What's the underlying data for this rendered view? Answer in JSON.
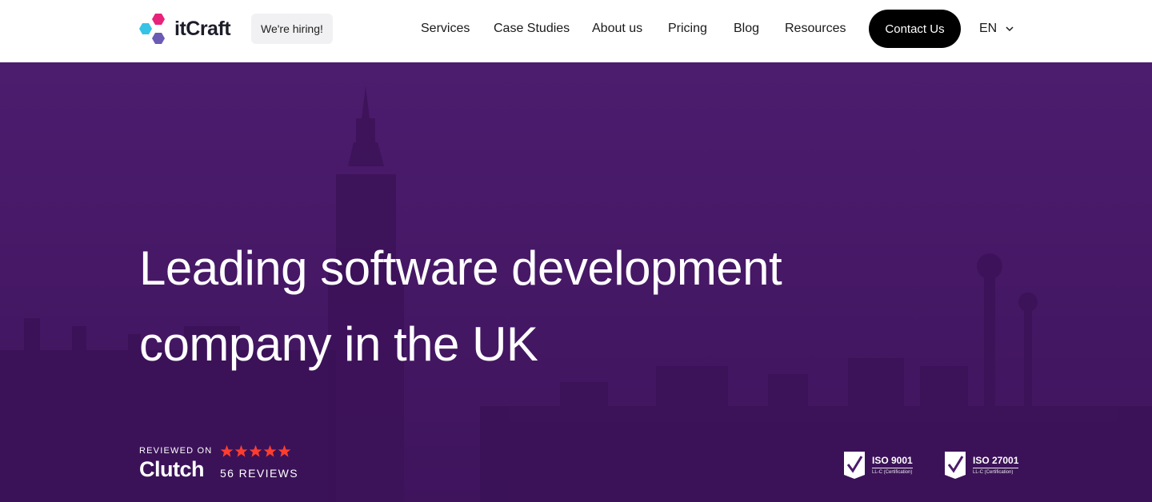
{
  "header": {
    "logo_text": "itCraft",
    "hiring_label": "We're hiring!",
    "nav": [
      {
        "label": "Services"
      },
      {
        "label": "Case Studies"
      },
      {
        "label": "About us"
      },
      {
        "label": "Pricing"
      },
      {
        "label": "Blog"
      },
      {
        "label": "Resources"
      }
    ],
    "contact_label": "Contact Us",
    "language": "EN"
  },
  "hero": {
    "headline_line1": "Leading software development",
    "headline_line2": "company in the UK",
    "clutch": {
      "reviewed_on": "REVIEWED ON",
      "brand": "Clutch",
      "reviews": "56 REVIEWS",
      "rating": 5
    },
    "certifications": [
      {
        "title": "ISO 9001",
        "sub": "LL-C (Certification)"
      },
      {
        "title": "ISO 27001",
        "sub": "LL-C (Certification)"
      }
    ]
  },
  "colors": {
    "hero_overlay": "#4a1a6b",
    "button_bg": "#000000",
    "star": "#ff3d2e",
    "logo_pink": "#e8237c",
    "logo_cyan": "#35c3e6",
    "logo_purple": "#6b5bb5"
  }
}
